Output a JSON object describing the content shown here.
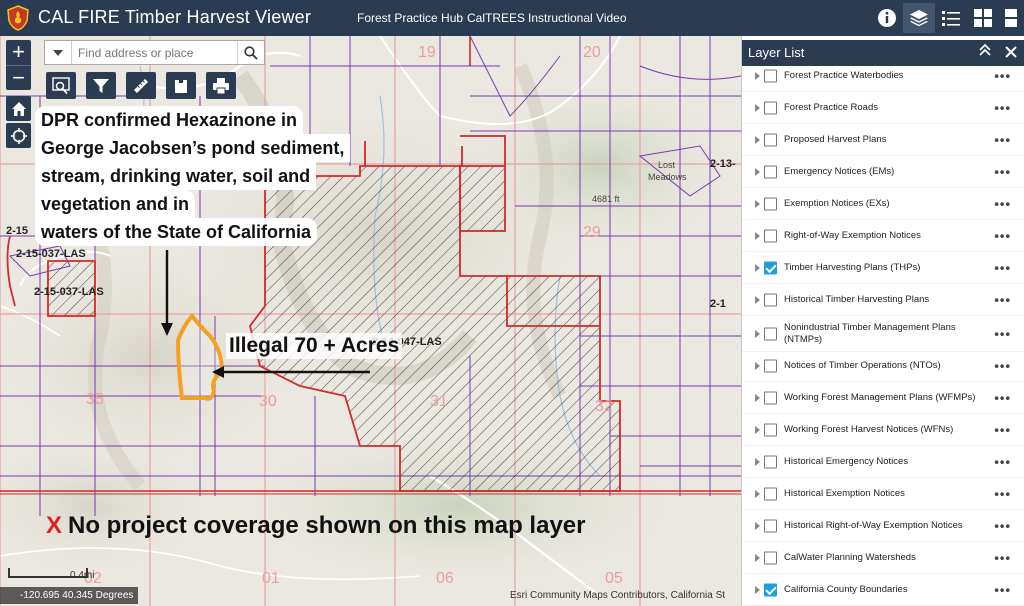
{
  "header": {
    "title": "CAL FIRE Timber Harvest Viewer",
    "links": [
      "Forest Practice Hub",
      "CalTREES",
      "Instructional Video"
    ],
    "icons": [
      "info-icon",
      "layers-icon",
      "legend-icon",
      "basemap-gallery-icon"
    ]
  },
  "map": {
    "search_placeholder": "Find address or place",
    "zoom_in": "+",
    "zoom_out": "−",
    "tools": [
      "identify-icon",
      "filter-icon",
      "measure-icon",
      "select-icon",
      "print-icon"
    ],
    "callout_lines": [
      "DPR confirmed Hexazinone in",
      "George Jacobsen’s pond sediment,",
      "stream, drinking water, soil and",
      "vegetation and in",
      "waters of the State of California"
    ],
    "illegal_label": "Illegal 70 + Acres",
    "bottom_note_x": "X",
    "bottom_note_text": "No project coverage shown on this map layer",
    "coords": "-120.695 40.345 Degrees",
    "scale_label": "0.4mi",
    "attribution": "Esri Community Maps Contributors, California St",
    "labels": {
      "thp_a": "2-15-037-LAS",
      "thp_b": "2-15-037-LAS",
      "thp_c": "2-15",
      "thp_d": "2-14-047-LAS",
      "thp_e": "2-13-",
      "thp_f": "2-1"
    },
    "terrain": {
      "lost_meadows_1": "Lost",
      "lost_meadows_2": "Meadows",
      "elev": "4681 ft"
    },
    "section_numbers": [
      "19",
      "20",
      "29",
      "35",
      "30",
      "31",
      "32",
      "01",
      "06",
      "05",
      "02"
    ],
    "colors": {
      "header": "#2b3b52",
      "thp_boundary": "#d42a2a",
      "parcel": "#6a2aa8",
      "illegal_outline": "#f5a020",
      "callout_x": "#e02020"
    }
  },
  "layer_panel": {
    "title": "Layer List",
    "layers": [
      {
        "label": "Forest Practice Waterbodies",
        "checked": false
      },
      {
        "label": "Forest Practice Roads",
        "checked": false
      },
      {
        "label": "Proposed Harvest Plans",
        "checked": false
      },
      {
        "label": "Emergency Notices (EMs)",
        "checked": false
      },
      {
        "label": "Exemption Notices (EXs)",
        "checked": false
      },
      {
        "label": "Right-of-Way Exemption Notices",
        "checked": false
      },
      {
        "label": "Timber Harvesting Plans (THPs)",
        "checked": true
      },
      {
        "label": "Historical Timber Harvesting Plans",
        "checked": false
      },
      {
        "label": "Nonindustrial Timber Management Plans (NTMPs)",
        "checked": false
      },
      {
        "label": "Notices of Timber Operations (NTOs)",
        "checked": false
      },
      {
        "label": "Working Forest Management Plans (WFMPs)",
        "checked": false
      },
      {
        "label": "Working Forest Harvest Notices (WFNs)",
        "checked": false
      },
      {
        "label": "Historical Emergency Notices",
        "checked": false
      },
      {
        "label": "Historical Exemption Notices",
        "checked": false
      },
      {
        "label": "Historical Right-of-Way Exemption Notices",
        "checked": false
      },
      {
        "label": "CalWater Planning Watersheds",
        "checked": false
      },
      {
        "label": "California County Boundaries",
        "checked": true
      }
    ]
  }
}
